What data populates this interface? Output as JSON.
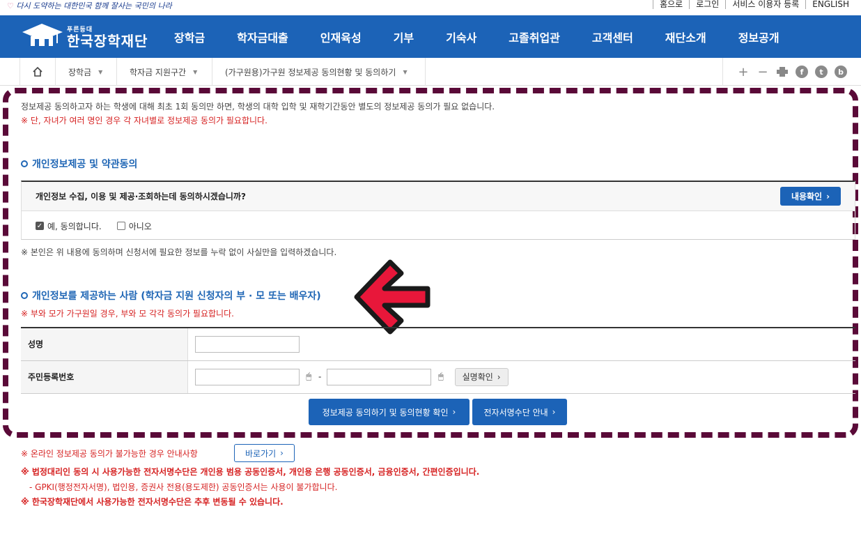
{
  "topbar": {
    "slogan": "다시 도약하는 대한민국  함께 잘사는 국민의 나라",
    "links": [
      "홈으로",
      "로그인",
      "서비스 이용자 등록",
      "ENGLISH"
    ]
  },
  "header": {
    "logo_small": "푸른등대",
    "logo_main": "한국장학재단",
    "nav": [
      "장학금",
      "학자금대출",
      "인재육성",
      "기부",
      "기숙사",
      "고졸취업관",
      "고객센터",
      "재단소개",
      "정보공개"
    ]
  },
  "breadcrumb": {
    "items": [
      "장학금",
      "학자금 지원구간",
      "(가구원용)가구원 정보제공 동의현황 및 동의하기"
    ]
  },
  "tools": [
    "+",
    "−",
    "print",
    "f",
    "t",
    "b"
  ],
  "content": {
    "intro_line1": "정보제공 동의하고자 하는 학생에 대해 최초 1회 동의만 하면, 학생의 대학 입학 및 재학기간동안 별도의 정보제공 동의가 필요 없습니다.",
    "intro_line2": "※ 단, 자녀가 여러 명인 경우 각 자녀별로 정보제공 동의가 필요합니다.",
    "section1_title": "개인정보제공 및 약관동의",
    "agree_question": "개인정보 수집, 이용 및 제공·조회하는데 동의하시겠습니까?",
    "view_button": "내용확인",
    "option_yes": "예, 동의합니다.",
    "option_no": "아니오",
    "note_truth": "※ 본인은 위 내용에 동의하며 신청서에 필요한 정보를 누락 없이 사실만을 입력하겠습니다.",
    "section2_title": "개인정보를 제공하는 사람 (학자금 지원 신청자의 부 · 모 또는 배우자)",
    "section2_note": "※ 부와 모가 가구원일 경우, 부와 모 각각 동의가 필요합니다.",
    "field_name": "성명",
    "field_rrn": "주민등록번호",
    "dash": "-",
    "verify_button": "실명확인",
    "submit_button": "정보제공 동의하기 및 동의현황 확인",
    "esign_button": "전자서명수단 안내"
  },
  "footer_notes": {
    "online_unavailable": "※ 온라인 정보제공 동의가 불가능한 경우 안내사항",
    "shortcut_button": "바로가기",
    "legal_rep": "※ 법정대리인 동의 시 사용가능한 전자서명수단은 개인용 범용 공동인증서, 개인용 은행 공동인증서, 금융인증서, 간편인증입니다.",
    "gpki": "- GPKI(행정전자서명), 법인용, 증권사 전용(용도제한) 공동인증서는 사용이 불가합니다.",
    "change_notice": "※ 한국장학재단에서 사용가능한 전자서명수단은 추후 변동될 수 있습니다."
  },
  "colors": {
    "brand": "#1c63b7",
    "highlight_frame": "#5a0a38",
    "arrow": "#e8173a",
    "notice_red": "#d62222"
  }
}
